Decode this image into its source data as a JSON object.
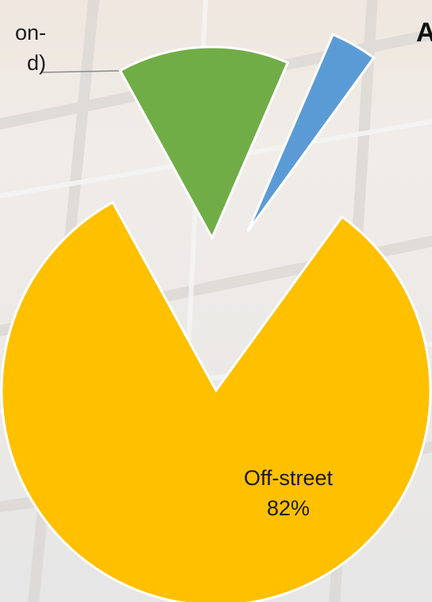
{
  "title": "A",
  "colors": {
    "off_street": "#FFC000",
    "green_segment": "#70AD47",
    "blue_segment": "#5B9BD5",
    "leader_line": "#8a8a8a"
  },
  "chart_data": {
    "type": "pie",
    "exploded": true,
    "title": "A",
    "slices": [
      {
        "name": "Off-street",
        "value": 82,
        "value_label": "82%",
        "color": "#FFC000"
      },
      {
        "name": "",
        "label_fragments": [
          "on-",
          "d)"
        ],
        "value": 14.5,
        "color": "#70AD47"
      },
      {
        "name": "",
        "value": 3.5,
        "color": "#5B9BD5"
      }
    ]
  },
  "labels": {
    "off_street_name": "Off-street",
    "off_street_pct": "82%",
    "green_line1": "on-",
    "green_line2": "d)"
  }
}
